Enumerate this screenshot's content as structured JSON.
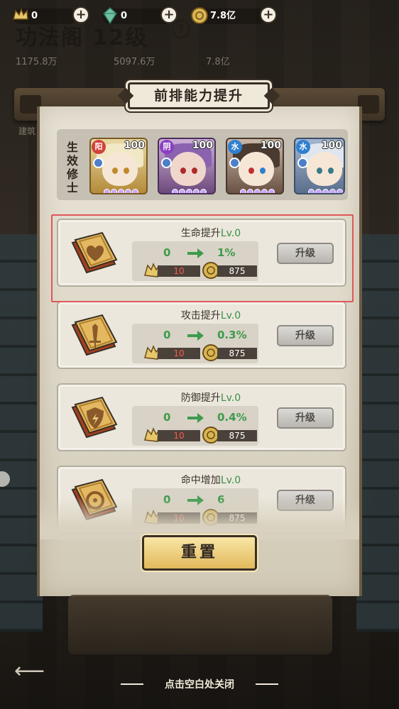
{
  "topbar": {
    "resources": [
      {
        "icon": "crown-ticket-icon",
        "value": "0"
      },
      {
        "icon": "green-gem-icon",
        "value": "0"
      },
      {
        "icon": "gold-coin-icon",
        "value": "7.8亿"
      }
    ]
  },
  "background": {
    "title": "功法阁 12级",
    "help": "?",
    "resources": [
      "1175.8万",
      "5097.6万",
      "7.8亿"
    ],
    "building_label": "建筑"
  },
  "panel": {
    "title": "前排能力提升",
    "team_label": "生效修士",
    "heroes": [
      {
        "element": "阳",
        "level": "100",
        "element_color": "#d1423a"
      },
      {
        "element": "阴",
        "level": "100",
        "element_color": "#8a3fc0"
      },
      {
        "element": "水",
        "level": "100",
        "element_color": "#2f7fd0"
      },
      {
        "element": "水",
        "level": "100",
        "element_color": "#2f7fd0"
      }
    ],
    "abilities": [
      {
        "name": "生命提升",
        "level": "Lv.0",
        "from": "0",
        "to": "1%",
        "cost_scroll": "10",
        "cost_coin": "875",
        "button": "升级",
        "book_icon": "heart-icon"
      },
      {
        "name": "攻击提升",
        "level": "Lv.0",
        "from": "0",
        "to": "0.3%",
        "cost_scroll": "10",
        "cost_coin": "875",
        "button": "升级",
        "book_icon": "sword-icon"
      },
      {
        "name": "防御提升",
        "level": "Lv.0",
        "from": "0",
        "to": "0.4%",
        "cost_scroll": "10",
        "cost_coin": "875",
        "button": "升级",
        "book_icon": "shield-icon"
      },
      {
        "name": "命中增加",
        "level": "Lv.0",
        "from": "0",
        "to": "6",
        "cost_scroll": "10",
        "cost_coin": "875",
        "button": "升级",
        "book_icon": "target-icon"
      }
    ],
    "reset_label": "重置",
    "close_hint": "点击空白处关闭"
  },
  "colors": {
    "accent_green": "#3f9a4c",
    "cost_red": "#ff5a4a",
    "highlight": "#e0575a",
    "gold_button": "#e3b95c"
  }
}
